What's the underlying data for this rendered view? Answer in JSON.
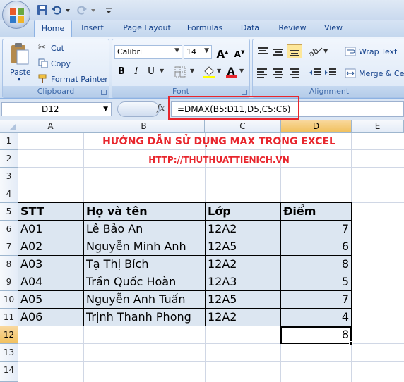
{
  "ribbon_tabs": [
    "Home",
    "Insert",
    "Page Layout",
    "Formulas",
    "Data",
    "Review",
    "View"
  ],
  "active_tab": "Home",
  "clipboard": {
    "paste": "Paste",
    "cut": "Cut",
    "copy": "Copy",
    "format_painter": "Format Painter",
    "group_label": "Clipboard"
  },
  "font": {
    "name": "Calibri",
    "size": "14",
    "grow": "A",
    "shrink": "A",
    "bold": "B",
    "italic": "I",
    "underline": "U",
    "font_color_letter": "A",
    "group_label": "Font"
  },
  "alignment": {
    "wrap_text": "Wrap Text",
    "merge_center": "Merge & Cer",
    "group_label": "Alignment"
  },
  "formula_bar": {
    "name_box": "D12",
    "fx": "fx",
    "formula": "=DMAX(B5:D11,D5,C5:C6)"
  },
  "sheet": {
    "columns": [
      "A",
      "B",
      "C",
      "D",
      "E"
    ],
    "selected_column": "D",
    "rows": [
      "1",
      "2",
      "3",
      "4",
      "5",
      "6",
      "7",
      "8",
      "9",
      "10",
      "11",
      "12",
      "13",
      "14"
    ],
    "selected_row": "12",
    "title": "HƯỚNG DẪN SỬ DỤNG MAX TRONG EXCEL",
    "url": "HTTP://THUTHUATTIENICH.VN",
    "headers": [
      "STT",
      "Họ và tên",
      "Lớp",
      "Điểm"
    ],
    "records": [
      [
        "A01",
        "Lê Bảo An",
        "12A2",
        "7"
      ],
      [
        "A02",
        "Nguyễn Minh Anh",
        "12A5",
        "6"
      ],
      [
        "A03",
        "Tạ Thị Bích",
        "12A2",
        "8"
      ],
      [
        "A04",
        "Trần Quốc Hoàn",
        "12A3",
        "5"
      ],
      [
        "A05",
        "Nguyễn Anh Tuấn",
        "12A5",
        "7"
      ],
      [
        "A06",
        "Trịnh Thanh Phong",
        "12A2",
        "4"
      ]
    ],
    "result": "8"
  },
  "colors": {
    "accent_red": "#e8262d",
    "table_fill": "#dce6f1",
    "selection_header": "#f1c15f"
  }
}
